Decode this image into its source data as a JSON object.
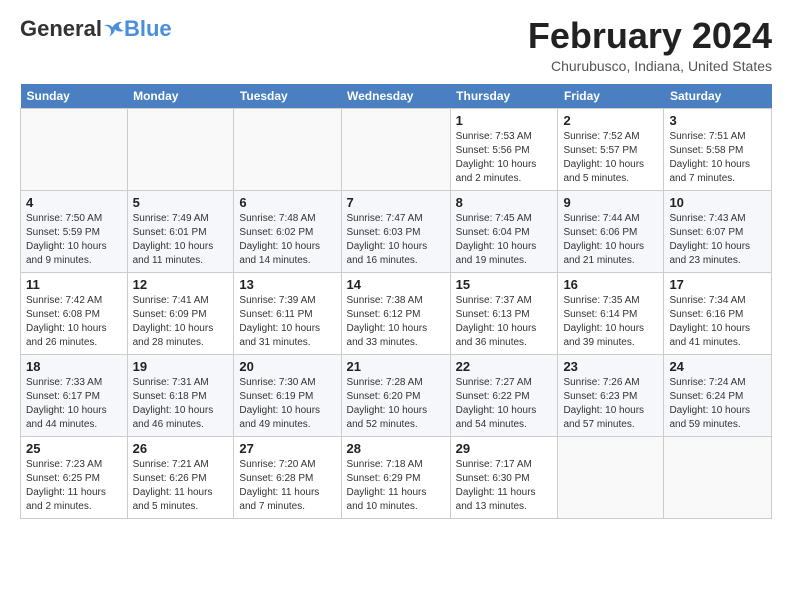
{
  "header": {
    "logo": {
      "general": "General",
      "blue": "Blue",
      "tagline": ""
    },
    "title": "February 2024",
    "location": "Churubusco, Indiana, United States"
  },
  "days_of_week": [
    "Sunday",
    "Monday",
    "Tuesday",
    "Wednesday",
    "Thursday",
    "Friday",
    "Saturday"
  ],
  "weeks": [
    [
      {
        "day": "",
        "empty": true
      },
      {
        "day": "",
        "empty": true
      },
      {
        "day": "",
        "empty": true
      },
      {
        "day": "",
        "empty": true
      },
      {
        "day": "1",
        "sunrise": "7:53 AM",
        "sunset": "5:56 PM",
        "daylight": "10 hours and 2 minutes."
      },
      {
        "day": "2",
        "sunrise": "7:52 AM",
        "sunset": "5:57 PM",
        "daylight": "10 hours and 5 minutes."
      },
      {
        "day": "3",
        "sunrise": "7:51 AM",
        "sunset": "5:58 PM",
        "daylight": "10 hours and 7 minutes."
      }
    ],
    [
      {
        "day": "4",
        "sunrise": "7:50 AM",
        "sunset": "5:59 PM",
        "daylight": "10 hours and 9 minutes."
      },
      {
        "day": "5",
        "sunrise": "7:49 AM",
        "sunset": "6:01 PM",
        "daylight": "10 hours and 11 minutes."
      },
      {
        "day": "6",
        "sunrise": "7:48 AM",
        "sunset": "6:02 PM",
        "daylight": "10 hours and 14 minutes."
      },
      {
        "day": "7",
        "sunrise": "7:47 AM",
        "sunset": "6:03 PM",
        "daylight": "10 hours and 16 minutes."
      },
      {
        "day": "8",
        "sunrise": "7:45 AM",
        "sunset": "6:04 PM",
        "daylight": "10 hours and 19 minutes."
      },
      {
        "day": "9",
        "sunrise": "7:44 AM",
        "sunset": "6:06 PM",
        "daylight": "10 hours and 21 minutes."
      },
      {
        "day": "10",
        "sunrise": "7:43 AM",
        "sunset": "6:07 PM",
        "daylight": "10 hours and 23 minutes."
      }
    ],
    [
      {
        "day": "11",
        "sunrise": "7:42 AM",
        "sunset": "6:08 PM",
        "daylight": "10 hours and 26 minutes."
      },
      {
        "day": "12",
        "sunrise": "7:41 AM",
        "sunset": "6:09 PM",
        "daylight": "10 hours and 28 minutes."
      },
      {
        "day": "13",
        "sunrise": "7:39 AM",
        "sunset": "6:11 PM",
        "daylight": "10 hours and 31 minutes."
      },
      {
        "day": "14",
        "sunrise": "7:38 AM",
        "sunset": "6:12 PM",
        "daylight": "10 hours and 33 minutes."
      },
      {
        "day": "15",
        "sunrise": "7:37 AM",
        "sunset": "6:13 PM",
        "daylight": "10 hours and 36 minutes."
      },
      {
        "day": "16",
        "sunrise": "7:35 AM",
        "sunset": "6:14 PM",
        "daylight": "10 hours and 39 minutes."
      },
      {
        "day": "17",
        "sunrise": "7:34 AM",
        "sunset": "6:16 PM",
        "daylight": "10 hours and 41 minutes."
      }
    ],
    [
      {
        "day": "18",
        "sunrise": "7:33 AM",
        "sunset": "6:17 PM",
        "daylight": "10 hours and 44 minutes."
      },
      {
        "day": "19",
        "sunrise": "7:31 AM",
        "sunset": "6:18 PM",
        "daylight": "10 hours and 46 minutes."
      },
      {
        "day": "20",
        "sunrise": "7:30 AM",
        "sunset": "6:19 PM",
        "daylight": "10 hours and 49 minutes."
      },
      {
        "day": "21",
        "sunrise": "7:28 AM",
        "sunset": "6:20 PM",
        "daylight": "10 hours and 52 minutes."
      },
      {
        "day": "22",
        "sunrise": "7:27 AM",
        "sunset": "6:22 PM",
        "daylight": "10 hours and 54 minutes."
      },
      {
        "day": "23",
        "sunrise": "7:26 AM",
        "sunset": "6:23 PM",
        "daylight": "10 hours and 57 minutes."
      },
      {
        "day": "24",
        "sunrise": "7:24 AM",
        "sunset": "6:24 PM",
        "daylight": "10 hours and 59 minutes."
      }
    ],
    [
      {
        "day": "25",
        "sunrise": "7:23 AM",
        "sunset": "6:25 PM",
        "daylight": "11 hours and 2 minutes."
      },
      {
        "day": "26",
        "sunrise": "7:21 AM",
        "sunset": "6:26 PM",
        "daylight": "11 hours and 5 minutes."
      },
      {
        "day": "27",
        "sunrise": "7:20 AM",
        "sunset": "6:28 PM",
        "daylight": "11 hours and 7 minutes."
      },
      {
        "day": "28",
        "sunrise": "7:18 AM",
        "sunset": "6:29 PM",
        "daylight": "11 hours and 10 minutes."
      },
      {
        "day": "29",
        "sunrise": "7:17 AM",
        "sunset": "6:30 PM",
        "daylight": "11 hours and 13 minutes."
      },
      {
        "day": "",
        "empty": true
      },
      {
        "day": "",
        "empty": true
      }
    ]
  ],
  "labels": {
    "sunrise": "Sunrise:",
    "sunset": "Sunset:",
    "daylight": "Daylight:"
  }
}
